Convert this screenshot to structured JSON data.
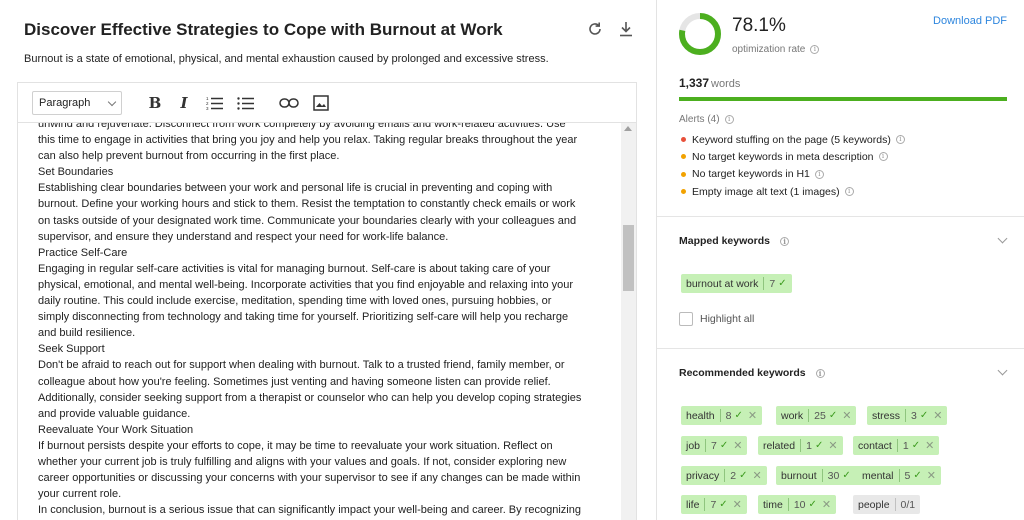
{
  "editor": {
    "title": "Discover Effective Strategies to Cope with Burnout at Work",
    "description": "Burnout is a state of emotional, physical, and mental exhaustion caused by prolonged and excessive stress.",
    "refresh_icon": "refresh-icon",
    "download_icon": "download-icon",
    "toolbar": {
      "format_value": "Paragraph",
      "icons": [
        "bold-icon",
        "italic-icon",
        "ordered-list-icon",
        "bullet-list-icon",
        "link-icon",
        "image-icon"
      ]
    },
    "lines": [
      "unwind and rejuvenate. Disconnect from work completely by avoiding emails and work-related activities. Use",
      "this time to engage in activities that bring you joy and help you relax. Taking regular breaks throughout the year",
      "can also help prevent burnout from occurring in the first place.",
      "Set Boundaries",
      "Establishing clear boundaries between your work and personal life is crucial in preventing and coping with",
      "burnout. Define your working hours and stick to them. Resist the temptation to constantly check emails or work",
      "on tasks outside of your designated work time. Communicate your boundaries clearly with your colleagues and",
      "supervisor, and ensure they understand and respect your need for work-life balance.",
      "Practice Self-Care",
      "Engaging in regular self-care activities is vital for managing burnout. Self-care is about taking care of your",
      "physical, emotional, and mental well-being. Incorporate activities that you find enjoyable and relaxing into your",
      "daily routine. This could include exercise, meditation, spending time with loved ones, pursuing hobbies, or",
      "simply disconnecting from technology and taking time for yourself. Prioritizing self-care will help you recharge",
      "and build resilience.",
      "Seek Support",
      "Don't be afraid to reach out for support when dealing with burnout. Talk to a trusted friend, family member, or",
      "colleague about how you're feeling. Sometimes just venting and having someone listen can provide relief.",
      "Additionally, consider seeking support from a therapist or counselor who can help you develop coping strategies",
      "and provide valuable guidance.",
      "Reevaluate Your Work Situation",
      "If burnout persists despite your efforts to cope, it may be time to reevaluate your work situation. Reflect on",
      "whether your current job is truly fulfilling and aligns with your values and goals. If not, consider exploring new",
      "career opportunities or discussing your concerns with your supervisor to see if any changes can be made within",
      "your current role.",
      "In conclusion, burnout is a serious issue that can significantly impact your well-being and career. By recognizing"
    ]
  },
  "sidebar": {
    "rate_value": "78.1%",
    "rate_fraction": 0.781,
    "rate_label": "optimization rate",
    "download_label": "Download PDF",
    "word_count": "1,337",
    "word_label": "words",
    "word_progress": 1.0,
    "alerts_title": "Alerts (4)",
    "alerts": [
      {
        "text": "Keyword stuffing on the page (5 keywords)",
        "color": "#e8503a"
      },
      {
        "text": "No target keywords in meta description",
        "color": "#f2a200"
      },
      {
        "text": "No target keywords in H1",
        "color": "#f2a200"
      },
      {
        "text": "Empty image alt text (1 images)",
        "color": "#f2a200"
      }
    ],
    "mapped": {
      "title": "Mapped keywords",
      "tags": [
        {
          "keyword": "burnout at work",
          "count": "7"
        }
      ],
      "highlight_label": "Highlight all"
    },
    "recommended": {
      "title": "Recommended keywords",
      "tags": [
        {
          "keyword": "health",
          "count": "8",
          "status": "ok"
        },
        {
          "keyword": "work",
          "count": "25",
          "status": "ok"
        },
        {
          "keyword": "stress",
          "count": "3",
          "status": "ok"
        },
        {
          "keyword": "job",
          "count": "7",
          "status": "ok"
        },
        {
          "keyword": "related",
          "count": "1",
          "status": "ok"
        },
        {
          "keyword": "contact",
          "count": "1",
          "status": "ok"
        },
        {
          "keyword": "privacy",
          "count": "2",
          "status": "ok"
        },
        {
          "keyword": "burnout",
          "count": "30",
          "status": "ok"
        },
        {
          "keyword": "mental",
          "count": "5",
          "status": "ok"
        },
        {
          "keyword": "life",
          "count": "7",
          "status": "ok"
        },
        {
          "keyword": "time",
          "count": "10",
          "status": "ok"
        },
        {
          "keyword": "people",
          "count": "0/1",
          "status": "missing"
        }
      ]
    },
    "colors": {
      "accent": "#4caf1f",
      "link": "#2e86de",
      "tag_bg": "#c6f0b6"
    }
  }
}
